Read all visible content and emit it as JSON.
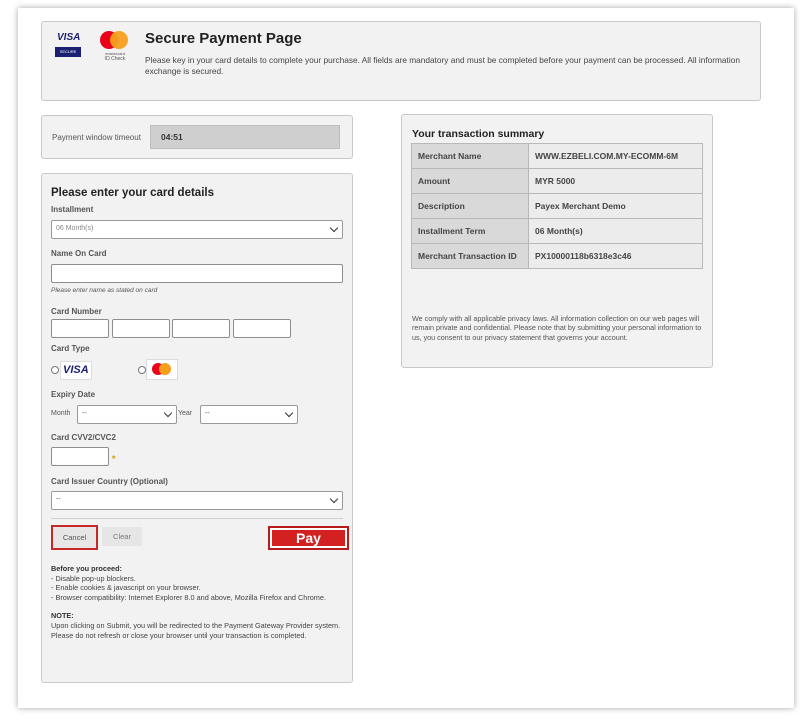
{
  "header": {
    "visa_brand": "VISA",
    "visa_secure": "SECURE",
    "mastercard_brand": "mastercard",
    "mastercard_sub": "ID Check",
    "title": "Secure Payment Page",
    "description": "Please key in your card details to complete your purchase. All fields are mandatory and must be completed before your payment can be processed. All information exchange is secured."
  },
  "timeout": {
    "label": "Payment window timeout",
    "value": "04:51"
  },
  "card_form": {
    "title": "Please enter your card details",
    "installment_label": "Installment",
    "installment_value": "06 Month(s)",
    "name_label": "Name On Card",
    "name_value": "",
    "name_hint": "Please enter name as stated on card",
    "card_number_label": "Card Number",
    "card_type_label": "Card Type",
    "card_types": [
      "VISA",
      "Mastercard"
    ],
    "expiry_label": "Expiry Date",
    "month_label": "Month",
    "month_value": "--",
    "year_label": "Year",
    "year_value": "--",
    "cvv_label": "Card CVV2/CVC2",
    "issuer_country_label": "Card Issuer Country (Optional)",
    "issuer_country_value": "--",
    "cancel_label": "Cancel",
    "clear_label": "Clear",
    "pay_label": "Pay"
  },
  "notes": {
    "before_title": "Before you proceed:",
    "before_items": [
      "- Disable pop-up blockers.",
      "- Enable cookies & javascript on your browser.",
      "- Browser compatibility: Internet Explorer 8.0 and above, Mozilla Firefox and Chrome."
    ],
    "note_title": "NOTE:",
    "note_text": "Upon clicking on Submit, you will be redirected to the Payment Gateway Provider system. Please do not refresh or close your browser until your transaction is completed."
  },
  "summary": {
    "title": "Your transaction summary",
    "rows": [
      {
        "key": "Merchant Name",
        "value": "WWW.EZBELI.COM.MY-ECOMM-6M"
      },
      {
        "key": "Amount",
        "value": "MYR 5000"
      },
      {
        "key": "Description",
        "value": "Payex Merchant Demo"
      },
      {
        "key": "Installment Term",
        "value": "06 Month(s)"
      },
      {
        "key": "Merchant Transaction ID",
        "value": "PX10000118b6318e3c46"
      }
    ],
    "privacy": "We comply with all applicable privacy laws. All information collection on our web pages will remain private and confidential. Please note that by submitting your personal information to us, you consent to our privacy statement that governs your account."
  },
  "colors": {
    "pay_button": "#d32020",
    "cancel_border": "#c62828",
    "visa_blue": "#1a1f71"
  }
}
